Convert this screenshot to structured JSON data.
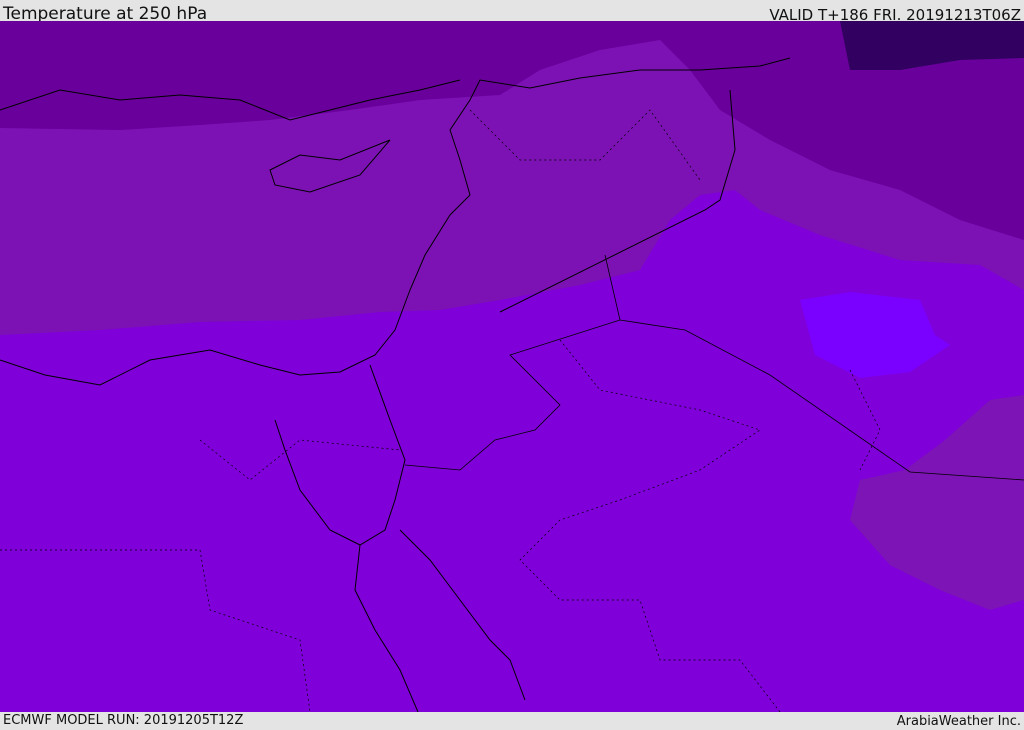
{
  "header": {
    "title": "Temperature at 250 hPa",
    "valid": "VALID T+186 FRI. 20191213T06Z"
  },
  "footer": {
    "model_run": "ECMWF MODEL RUN: 20191205T12Z",
    "brand": "ArabiaWeather Inc."
  },
  "colors": {
    "base": "#7f00d9",
    "band": "#7c12b4",
    "upper": "#69009b",
    "dark": "#320060",
    "warm_blob": "#7a00ff",
    "east": "#7d14b5"
  }
}
